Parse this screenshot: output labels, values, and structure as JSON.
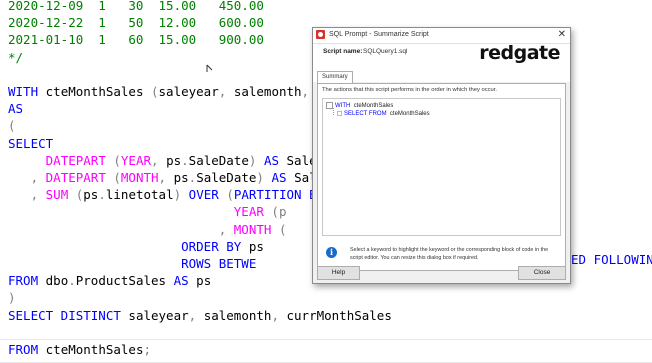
{
  "editor": {
    "lines": [
      {
        "row": 0,
        "parts": [
          {
            "cls": "c",
            "text": "2020-12-09  1   30  15.00   450.00"
          }
        ]
      },
      {
        "row": 1,
        "parts": [
          {
            "cls": "c",
            "text": "2020-12-22  1   50  12.00   600.00"
          }
        ]
      },
      {
        "row": 2,
        "parts": [
          {
            "cls": "c",
            "text": "2021-01-10  1   60  15.00   900.00"
          }
        ]
      },
      {
        "row": 3,
        "parts": [
          {
            "cls": "c",
            "text": "*/"
          }
        ]
      },
      {
        "row": 5,
        "parts": [
          {
            "cls": "k",
            "text": "WITH "
          },
          {
            "cls": "t",
            "text": "cteMonthSales "
          },
          {
            "cls": "g",
            "text": "("
          },
          {
            "cls": "t",
            "text": "saleyear"
          },
          {
            "cls": "g",
            "text": ", "
          },
          {
            "cls": "t",
            "text": "salemonth"
          },
          {
            "cls": "g",
            "text": ","
          }
        ]
      },
      {
        "row": 6,
        "parts": [
          {
            "cls": "k",
            "text": "AS"
          }
        ]
      },
      {
        "row": 7,
        "parts": [
          {
            "cls": "g",
            "text": "("
          }
        ]
      },
      {
        "row": 8,
        "parts": [
          {
            "cls": "k",
            "text": "SELECT"
          }
        ]
      },
      {
        "row": 9,
        "parts": [
          {
            "cls": "t",
            "text": "     "
          },
          {
            "cls": "f",
            "text": "DATEPART "
          },
          {
            "cls": "g",
            "text": "("
          },
          {
            "cls": "f",
            "text": "YEAR"
          },
          {
            "cls": "g",
            "text": ", "
          },
          {
            "cls": "t",
            "text": "ps"
          },
          {
            "cls": "g",
            "text": "."
          },
          {
            "cls": "t",
            "text": "SaleDate"
          },
          {
            "cls": "g",
            "text": ") "
          },
          {
            "cls": "k",
            "text": "AS "
          },
          {
            "cls": "t",
            "text": "Sale"
          }
        ]
      },
      {
        "row": 10,
        "parts": [
          {
            "cls": "t",
            "text": "   "
          },
          {
            "cls": "g",
            "text": ", "
          },
          {
            "cls": "f",
            "text": "DATEPART "
          },
          {
            "cls": "g",
            "text": "("
          },
          {
            "cls": "f",
            "text": "MONTH"
          },
          {
            "cls": "g",
            "text": ", "
          },
          {
            "cls": "t",
            "text": "ps"
          },
          {
            "cls": "g",
            "text": "."
          },
          {
            "cls": "t",
            "text": "SaleDate"
          },
          {
            "cls": "g",
            "text": ") "
          },
          {
            "cls": "k",
            "text": "AS "
          },
          {
            "cls": "t",
            "text": "Sal"
          }
        ]
      },
      {
        "row": 11,
        "parts": [
          {
            "cls": "t",
            "text": "   "
          },
          {
            "cls": "g",
            "text": ", "
          },
          {
            "cls": "f",
            "text": "SUM "
          },
          {
            "cls": "g",
            "text": "("
          },
          {
            "cls": "t",
            "text": "ps"
          },
          {
            "cls": "g",
            "text": "."
          },
          {
            "cls": "t",
            "text": "linetotal"
          },
          {
            "cls": "g",
            "text": ") "
          },
          {
            "cls": "k",
            "text": "OVER "
          },
          {
            "cls": "g",
            "text": "("
          },
          {
            "cls": "k",
            "text": "PARTITION B"
          }
        ]
      },
      {
        "row": 12,
        "parts": [
          {
            "cls": "t",
            "text": "                              "
          },
          {
            "cls": "f",
            "text": "YEAR "
          },
          {
            "cls": "g",
            "text": "(p"
          }
        ]
      },
      {
        "row": 13,
        "parts": [
          {
            "cls": "t",
            "text": "                            "
          },
          {
            "cls": "g",
            "text": ", "
          },
          {
            "cls": "f",
            "text": "MONTH "
          },
          {
            "cls": "g",
            "text": "("
          }
        ]
      },
      {
        "row": 14,
        "parts": [
          {
            "cls": "t",
            "text": "                       "
          },
          {
            "cls": "k",
            "text": "ORDER BY "
          },
          {
            "cls": "t",
            "text": "ps"
          }
        ]
      },
      {
        "row": 15,
        "parts": [
          {
            "cls": "t",
            "text": "                       "
          },
          {
            "cls": "k",
            "text": "ROWS BETWE"
          }
        ]
      },
      {
        "row": 16,
        "parts": [
          {
            "cls": "k",
            "text": "FROM "
          },
          {
            "cls": "t",
            "text": "dbo"
          },
          {
            "cls": "g",
            "text": "."
          },
          {
            "cls": "t",
            "text": "ProductSales "
          },
          {
            "cls": "k",
            "text": "AS "
          },
          {
            "cls": "t",
            "text": "ps"
          }
        ]
      },
      {
        "row": 17,
        "parts": [
          {
            "cls": "g",
            "text": ")"
          }
        ]
      },
      {
        "row": 18,
        "parts": [
          {
            "cls": "k",
            "text": "SELECT DISTINCT "
          },
          {
            "cls": "t",
            "text": "saleyear"
          },
          {
            "cls": "g",
            "text": ", "
          },
          {
            "cls": "t",
            "text": "salemonth"
          },
          {
            "cls": "g",
            "text": ", "
          },
          {
            "cls": "t",
            "text": "currMonthSales"
          }
        ]
      },
      {
        "row": 20,
        "parts": [
          {
            "cls": "k",
            "text": "FROM "
          },
          {
            "cls": "t",
            "text": "cteMonthSales"
          },
          {
            "cls": "g",
            "text": ";"
          }
        ]
      }
    ],
    "right_fragment": "ED FOLLOWIN"
  },
  "dialog": {
    "title": "SQL Prompt - Summarize Script",
    "close_glyph": "✕",
    "script_name_label": "Script name:",
    "script_name_value": "SQLQuery1.sql",
    "logo": "redgate",
    "tab_label": "Summary",
    "description": "The actions that this script performs in the order in which they occur.",
    "tree": [
      {
        "keyword": "WITH",
        "name": "cteMonthSales"
      },
      {
        "keyword": "SELECT FROM",
        "name": "cteMonthSales"
      }
    ],
    "hint": "Select a keyword to highlight the keyword or the corresponding block of code in the script editor. You can resize this dialog box if required.",
    "info_glyph": "i",
    "help_button": "Help",
    "close_button": "Close"
  },
  "icons": [
    "sql-prompt-app-icon",
    "close-icon",
    "info-icon",
    "tree-node-icon",
    "mouse-cursor-icon"
  ]
}
